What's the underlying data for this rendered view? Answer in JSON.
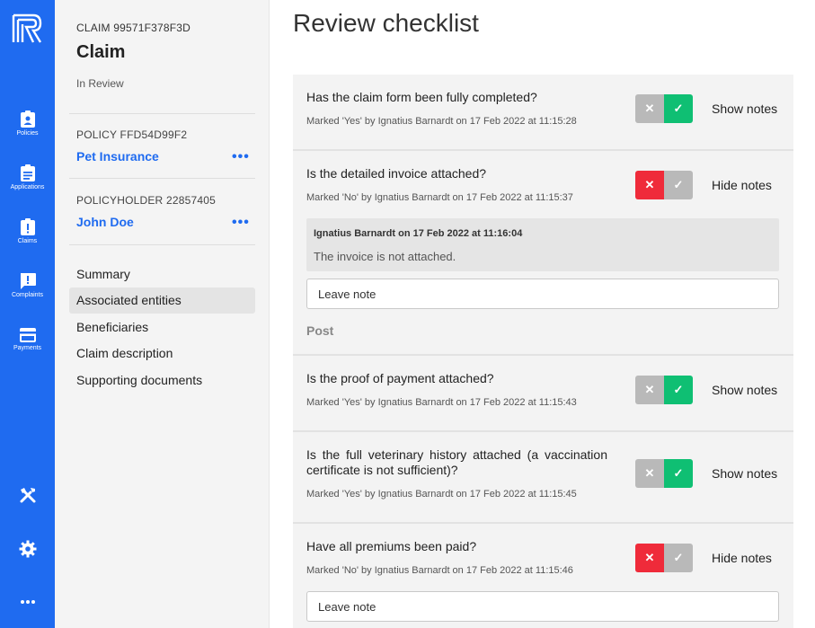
{
  "rail": {
    "items": [
      {
        "label": "Policies",
        "icon": "clipboard-person-icon"
      },
      {
        "label": "Applications",
        "icon": "clipboard-list-icon"
      },
      {
        "label": "Claims",
        "icon": "clipboard-alert-icon"
      },
      {
        "label": "Complaints",
        "icon": "chat-alert-icon"
      },
      {
        "label": "Payments",
        "icon": "credit-card-icon"
      }
    ],
    "bottom_icons": [
      "tools-icon",
      "gear-icon",
      "more-horizontal-icon"
    ],
    "accent_color": "#1f6bf0"
  },
  "claim": {
    "id": "CLAIM 99571F378F3D",
    "title": "Claim",
    "status": "In Review",
    "policy_label": "POLICY FFD54D99F2",
    "policy_name": "Pet Insurance",
    "policyholder_label": "POLICYHOLDER 22857405",
    "policyholder_name": "John Doe",
    "more_label": "•••",
    "menu": [
      "Summary",
      "Associated entities",
      "Beneficiaries",
      "Claim description",
      "Supporting documents"
    ],
    "active_menu_index": 1
  },
  "main": {
    "title": "Review checklist",
    "toggle_no_glyph": "✕",
    "toggle_yes_glyph": "✓",
    "items": [
      {
        "question": "Has the claim form been fully completed?",
        "marked": "Marked 'Yes' by Ignatius Barnardt on 17 Feb 2022 at 11:15:28",
        "answer": "yes",
        "notes_label": "Show notes"
      },
      {
        "question": "Is the detailed invoice attached?",
        "marked": "Marked 'No' by Ignatius Barnardt on 17 Feb 2022 at 11:15:37",
        "answer": "no",
        "notes_label": "Hide notes",
        "note_author": "Ignatius Barnardt on 17 Feb 2022 at 11:16:04",
        "note_text": "The invoice is not attached.",
        "note_placeholder": "Leave note",
        "post_label": "Post"
      },
      {
        "question": "Is the proof of payment attached?",
        "marked": "Marked 'Yes' by Ignatius Barnardt on 17 Feb 2022 at 11:15:43",
        "answer": "yes",
        "notes_label": "Show notes"
      },
      {
        "question_line1": "Is the full veterinary history attached (a vaccination",
        "question_line2": "certificate is not sufficient)?",
        "marked": "Marked 'Yes' by Ignatius Barnardt on 17 Feb 2022 at 11:15:45",
        "answer": "yes",
        "notes_label": "Show notes"
      },
      {
        "question": "Have all premiums been paid?",
        "marked": "Marked 'No' by Ignatius Barnardt on 17 Feb 2022 at 11:15:46",
        "answer": "no",
        "notes_label": "Hide notes",
        "note_placeholder": "Leave note"
      }
    ]
  },
  "colors": {
    "yes_active": "#0fbf73",
    "no_active": "#ef2b3a",
    "inactive": "#b9b9b9"
  }
}
